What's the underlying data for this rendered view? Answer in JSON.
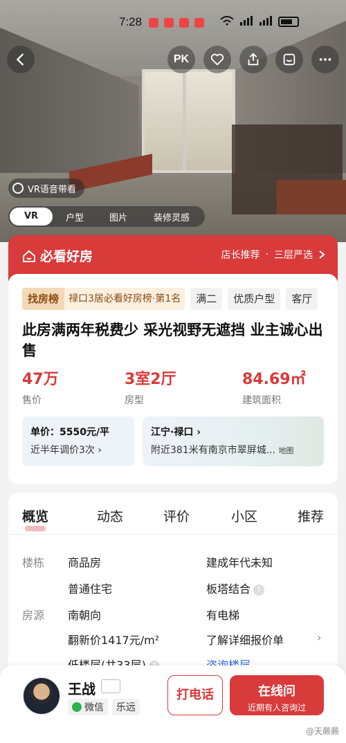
{
  "status_bar": {
    "time": "7:28"
  },
  "hero": {
    "top_buttons": {
      "pk_label": "PK"
    },
    "vr_badge": "VR语音带看",
    "media_tabs": [
      "VR",
      "户型",
      "图片",
      "装修灵感"
    ]
  },
  "banner": {
    "logo": "必看好房",
    "right_a": "店长推荐",
    "sep": "·",
    "right_b": "三层严选"
  },
  "listing": {
    "rank_badge": "找房榜",
    "rank_text": "禄口3居必看好房榜·第1名",
    "tags": [
      "满二",
      "优质户型",
      "客厅"
    ],
    "title": "此房满两年税费少 采光视野无遮挡 业主诚心出售",
    "stats": [
      {
        "value": "47万",
        "label": "售价"
      },
      {
        "value": "3室2厅",
        "label": "房型"
      },
      {
        "value": "84.69㎡",
        "label": "建筑面积"
      }
    ],
    "unit_price": "单价：5550元/平",
    "price_changes": "近半年调价3次",
    "location": "江宁·禄口",
    "nearby": "附近381米有南京市翠屏城...",
    "map_label": "地图"
  },
  "detail": {
    "tabs": [
      "概览",
      "动态",
      "评价",
      "小区",
      "推荐"
    ],
    "rows": {
      "building_label": "楼栋",
      "building_type": "商品房",
      "build_year": "建成年代未知",
      "residence_type": "普通住宅",
      "structure": "板塔结合",
      "source_label": "房源",
      "orientation": "南朝向",
      "elevator": "有电梯",
      "renovation_price": "翻新价1417元/m²",
      "price_sheet": "了解详细报价单",
      "floor": "低楼层(共33层)",
      "ask_floor": "咨询楼层"
    }
  },
  "agent": {
    "name": "王战",
    "wechat": "微信",
    "company": "乐远",
    "call_label": "打电话",
    "online_label": "在线问",
    "online_sub": "近期有人咨询过"
  },
  "watermark": "@天蕨蕨",
  "colors": {
    "brand_red": "#d93a3a",
    "link_blue": "#2f6be4"
  }
}
